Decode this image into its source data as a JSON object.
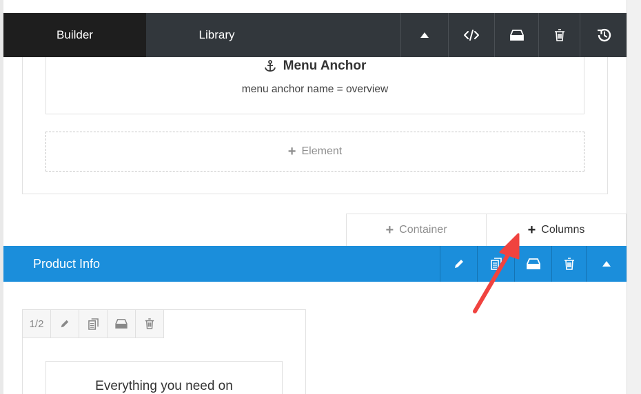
{
  "topbar": {
    "tabs": [
      {
        "label": "Builder",
        "active": true
      },
      {
        "label": "Library",
        "active": false
      }
    ],
    "actions": [
      {
        "icon": "collapse-up-icon"
      },
      {
        "icon": "code-icon"
      },
      {
        "icon": "save-drive-icon"
      },
      {
        "icon": "trash-icon"
      },
      {
        "icon": "history-icon"
      }
    ]
  },
  "menu_anchor": {
    "icon": "anchor-icon",
    "title": "Menu Anchor",
    "subtitle": "menu anchor name = overview"
  },
  "add_element": {
    "plus": "+",
    "label": "Element"
  },
  "add_container": {
    "plus": "+",
    "label": "Container"
  },
  "add_columns": {
    "plus": "+",
    "label": "Columns"
  },
  "product_section": {
    "title": "Product Info",
    "actions": [
      "edit-pencil-icon",
      "clone-icon",
      "save-drive-icon",
      "trash-icon",
      "collapse-up-icon"
    ]
  },
  "column": {
    "size_label": "1/2",
    "actions": [
      "edit-pencil-icon",
      "clone-icon",
      "save-drive-icon",
      "trash-icon"
    ]
  },
  "text_block": {
    "text": "Everything you need on"
  },
  "colors": {
    "topbar": "#32373c",
    "active_tab": "#1e1e1e",
    "section_bar": "#1b8edb",
    "annotation_arrow": "#f0433f"
  }
}
